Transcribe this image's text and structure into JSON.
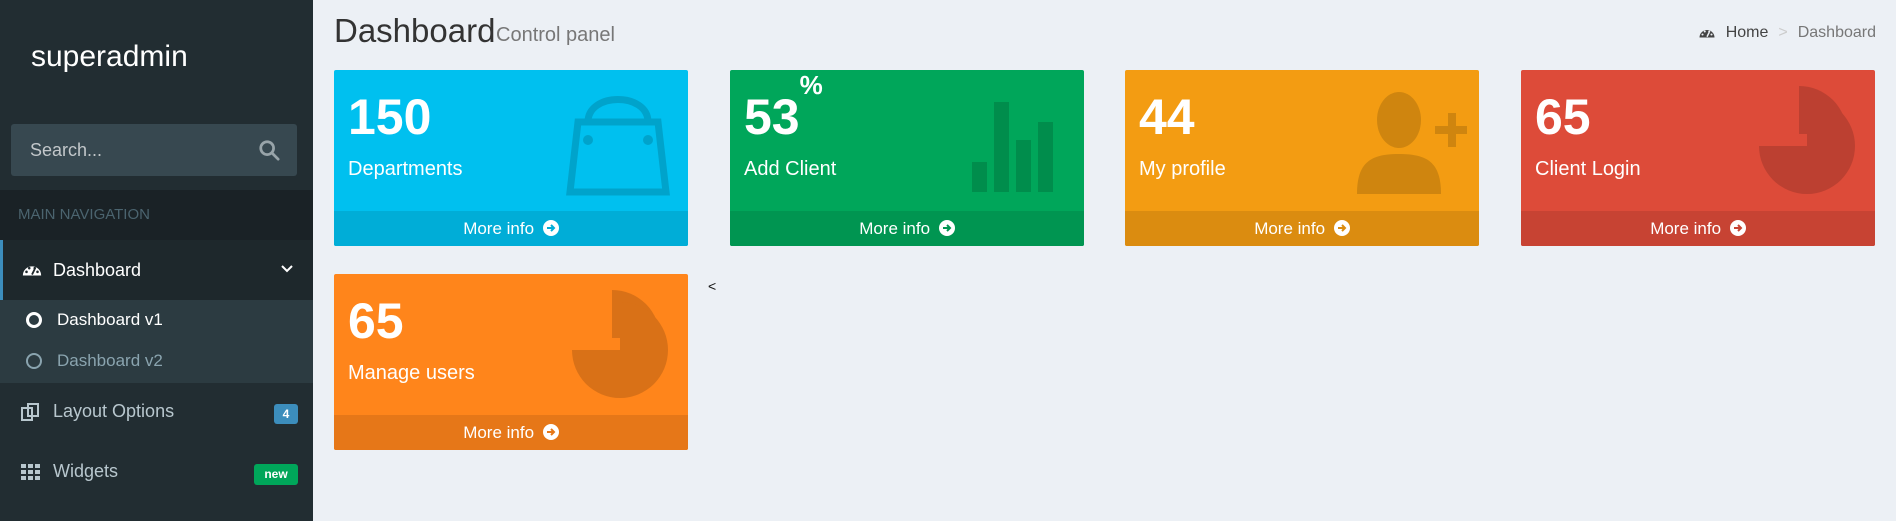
{
  "sidebar": {
    "brand": "superadmin",
    "search_placeholder": "Search...",
    "nav_header": "MAIN NAVIGATION",
    "active_item": {
      "label": "Dashboard",
      "icon": "dashboard-icon"
    },
    "subitems": [
      {
        "label": "Dashboard v1",
        "icon": "circle-icon"
      },
      {
        "label": "Dashboard v2",
        "icon": "circle-icon"
      }
    ],
    "items": [
      {
        "label": "Layout Options",
        "icon": "files-icon",
        "badge": "4",
        "badge_color": "#3c8dbc"
      },
      {
        "label": "Widgets",
        "icon": "grid-icon",
        "badge": "new",
        "badge_color": "#00a65a"
      }
    ]
  },
  "header": {
    "title": "Dashboard",
    "subtitle": "Control panel",
    "breadcrumb": [
      "Home",
      ">",
      "Dashboard"
    ]
  },
  "boxes": [
    {
      "value": "150",
      "suffix": "",
      "label": "Departments",
      "footer": "More info",
      "color": "#00c0ef",
      "icon": "shopping-bag-icon"
    },
    {
      "value": "53",
      "suffix": "%",
      "label": "Add Client",
      "footer": "More info",
      "color": "#00a65a",
      "icon": "bar-chart-icon"
    },
    {
      "value": "44",
      "suffix": "",
      "label": "My profile",
      "footer": "More info",
      "color": "#f39c12",
      "icon": "user-plus-icon"
    },
    {
      "value": "65",
      "suffix": "",
      "label": "Client Login",
      "footer": "More info",
      "color": "#dd4b39",
      "icon": "pie-chart-icon"
    },
    {
      "value": "65",
      "suffix": "",
      "label": "Manage users",
      "footer": "More info",
      "color": "#ff851b",
      "icon": "pie-chart-icon"
    }
  ],
  "stray_text": "<"
}
